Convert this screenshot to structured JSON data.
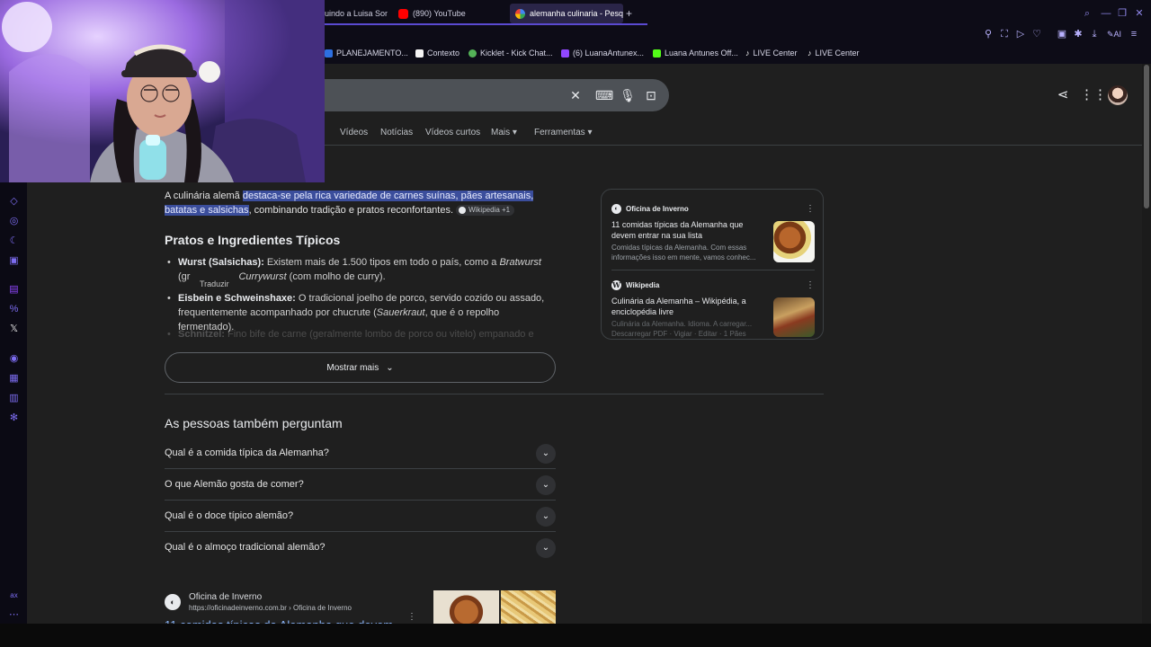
{
  "tabs": [
    {
      "label": "uindo a Luisa Son",
      "icon": "tab-icon"
    },
    {
      "label": "(890) YouTube",
      "icon": "youtube-icon"
    },
    {
      "label": "alemanha culinaria - Pesqu",
      "icon": "google-icon",
      "active": true
    },
    {
      "label": "+",
      "icon": "new-tab-icon"
    }
  ],
  "bookmarks": [
    {
      "label": "PLANEJAMENTO...",
      "icon": "trello-icon",
      "color": "#2d6fe0"
    },
    {
      "label": "Contexto",
      "icon": "doc-icon",
      "color": "#f5f5f5"
    },
    {
      "label": "Kicklet - Kick Chat...",
      "icon": "kicklet-icon",
      "color": "#54b257"
    },
    {
      "label": "(6) LuanaAntunex...",
      "icon": "twitch-icon",
      "color": "#9147ff"
    },
    {
      "label": "Luana Antunes Off...",
      "icon": "kick-icon",
      "color": "#53fc18"
    },
    {
      "label": "LIVE Center",
      "icon": "tiktok-icon",
      "color": "#f5f5f5"
    },
    {
      "label": "LIVE Center",
      "icon": "tiktok-icon",
      "color": "#f5f5f5"
    }
  ],
  "toolbar": {
    "ai_label": "AI"
  },
  "nav_tabs": [
    "Vídeos",
    "Notícias",
    "Vídeos curtos",
    "Mais",
    "Ferramentas"
  ],
  "overview": {
    "intro_plain": "A culinária alemã ",
    "intro_highlight_1": "destaca-se pela rica variedade de carnes suínas, pães artesanais,",
    "intro_highlight_2": "batatas e salsichas",
    "intro_rest": ", combinando tradição e pratos reconfortantes.",
    "citation": "Wikipedia +1",
    "heading": "Pratos e Ingredientes Típicos",
    "item1_bold": "Wurst (Salsichas):",
    "item1_text": " Existem mais de 1.500 tipos em todo o país, como a ",
    "item1_ital": "Bratwurst",
    "item1_line2a": "(gr",
    "item1_line2_ital": "Currywurst",
    "item1_line2b": " (com molho de curry).",
    "item2_bold": "Eisbein e Schweinshaxe:",
    "item2_text": " O tradicional joelho de porco, servido cozido ou assado,",
    "item2_line2a": "frequentemente acompanhado por chucrute (",
    "item2_ital": "Sauerkraut",
    "item2_line2b": ", que é o repolho fermentado).",
    "item3_bold": "Schnitzel:",
    "item3_text": " Fino bife de carne (geralmente lombo de porco ou vitelo) empanado e",
    "translate_tip": "Traduzir",
    "show_more": "Mostrar mais"
  },
  "sources": [
    {
      "site": "Oficina de Inverno",
      "title": "11 comidas típicas da Alemanha que devem entrar na sua lista",
      "snippet": "Comidas típicas da Alemanha. Com essas informações isso em mente, vamos conhec..."
    },
    {
      "site": "Wikipedia",
      "title": "Culinária da Alemanha – Wikipédia, a enciclopédia livre",
      "snippet": "Culinária da Alemanha. Idioma. A carregar... Descarregar PDF · Vigiar · Editar · 1 Pães"
    }
  ],
  "paa": {
    "title": "As pessoas também perguntam",
    "questions": [
      "Qual é a comida típica da Alemanha?",
      "O que Alemão gosta de comer?",
      "Qual é o doce típico alemão?",
      "Qual é o almoço tradicional alemão?"
    ]
  },
  "result": {
    "site": "Oficina de Inverno",
    "url": "https://oficinadeinverno.com.br › Oficina de Inverno",
    "title": "11 comidas típicas da Alemanha que devem"
  },
  "sidebar_bottom_label": "ax",
  "colors": {
    "accent": "#7c6cf0",
    "highlight": "#3b4e9c",
    "link": "#8ab4f8"
  }
}
